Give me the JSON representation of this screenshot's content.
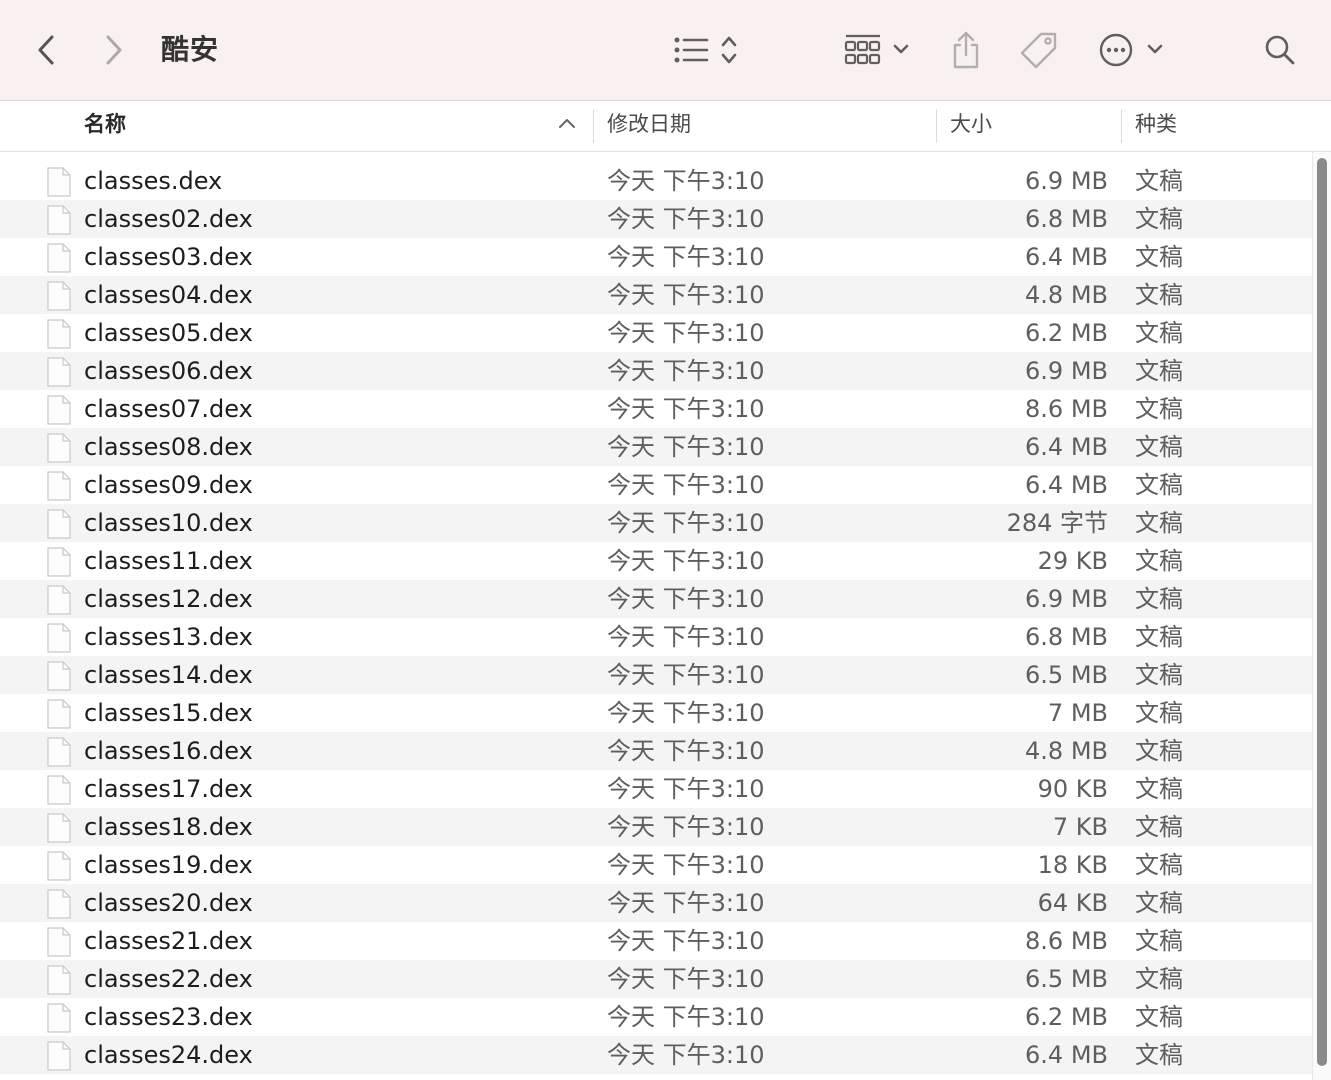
{
  "window": {
    "title": "酷安"
  },
  "toolbar": {
    "icons": [
      "back-icon",
      "forward-icon",
      "list-view-icon",
      "group-icon",
      "share-icon",
      "tag-icon",
      "more-icon",
      "search-icon"
    ]
  },
  "columns": {
    "name": "名称",
    "date": "修改日期",
    "size": "大小",
    "kind": "种类"
  },
  "files": [
    {
      "name": "classes.dex",
      "date": "今天 下午3:10",
      "size": "6.9 MB",
      "kind": "文稿"
    },
    {
      "name": "classes02.dex",
      "date": "今天 下午3:10",
      "size": "6.8 MB",
      "kind": "文稿"
    },
    {
      "name": "classes03.dex",
      "date": "今天 下午3:10",
      "size": "6.4 MB",
      "kind": "文稿"
    },
    {
      "name": "classes04.dex",
      "date": "今天 下午3:10",
      "size": "4.8 MB",
      "kind": "文稿"
    },
    {
      "name": "classes05.dex",
      "date": "今天 下午3:10",
      "size": "6.2 MB",
      "kind": "文稿"
    },
    {
      "name": "classes06.dex",
      "date": "今天 下午3:10",
      "size": "6.9 MB",
      "kind": "文稿"
    },
    {
      "name": "classes07.dex",
      "date": "今天 下午3:10",
      "size": "8.6 MB",
      "kind": "文稿"
    },
    {
      "name": "classes08.dex",
      "date": "今天 下午3:10",
      "size": "6.4 MB",
      "kind": "文稿"
    },
    {
      "name": "classes09.dex",
      "date": "今天 下午3:10",
      "size": "6.4 MB",
      "kind": "文稿"
    },
    {
      "name": "classes10.dex",
      "date": "今天 下午3:10",
      "size": "284 字节",
      "kind": "文稿"
    },
    {
      "name": "classes11.dex",
      "date": "今天 下午3:10",
      "size": "29 KB",
      "kind": "文稿"
    },
    {
      "name": "classes12.dex",
      "date": "今天 下午3:10",
      "size": "6.9 MB",
      "kind": "文稿"
    },
    {
      "name": "classes13.dex",
      "date": "今天 下午3:10",
      "size": "6.8 MB",
      "kind": "文稿"
    },
    {
      "name": "classes14.dex",
      "date": "今天 下午3:10",
      "size": "6.5 MB",
      "kind": "文稿"
    },
    {
      "name": "classes15.dex",
      "date": "今天 下午3:10",
      "size": "7 MB",
      "kind": "文稿"
    },
    {
      "name": "classes16.dex",
      "date": "今天 下午3:10",
      "size": "4.8 MB",
      "kind": "文稿"
    },
    {
      "name": "classes17.dex",
      "date": "今天 下午3:10",
      "size": "90 KB",
      "kind": "文稿"
    },
    {
      "name": "classes18.dex",
      "date": "今天 下午3:10",
      "size": "7 KB",
      "kind": "文稿"
    },
    {
      "name": "classes19.dex",
      "date": "今天 下午3:10",
      "size": "18 KB",
      "kind": "文稿"
    },
    {
      "name": "classes20.dex",
      "date": "今天 下午3:10",
      "size": "64 KB",
      "kind": "文稿"
    },
    {
      "name": "classes21.dex",
      "date": "今天 下午3:10",
      "size": "8.6 MB",
      "kind": "文稿"
    },
    {
      "name": "classes22.dex",
      "date": "今天 下午3:10",
      "size": "6.5 MB",
      "kind": "文稿"
    },
    {
      "name": "classes23.dex",
      "date": "今天 下午3:10",
      "size": "6.2 MB",
      "kind": "文稿"
    },
    {
      "name": "classes24.dex",
      "date": "今天 下午3:10",
      "size": "6.4 MB",
      "kind": "文稿"
    }
  ],
  "colors": {
    "toolbar_bg": "#f8f1f0",
    "row_alt": "#f4f4f5",
    "icon": "#5f5f5f"
  }
}
